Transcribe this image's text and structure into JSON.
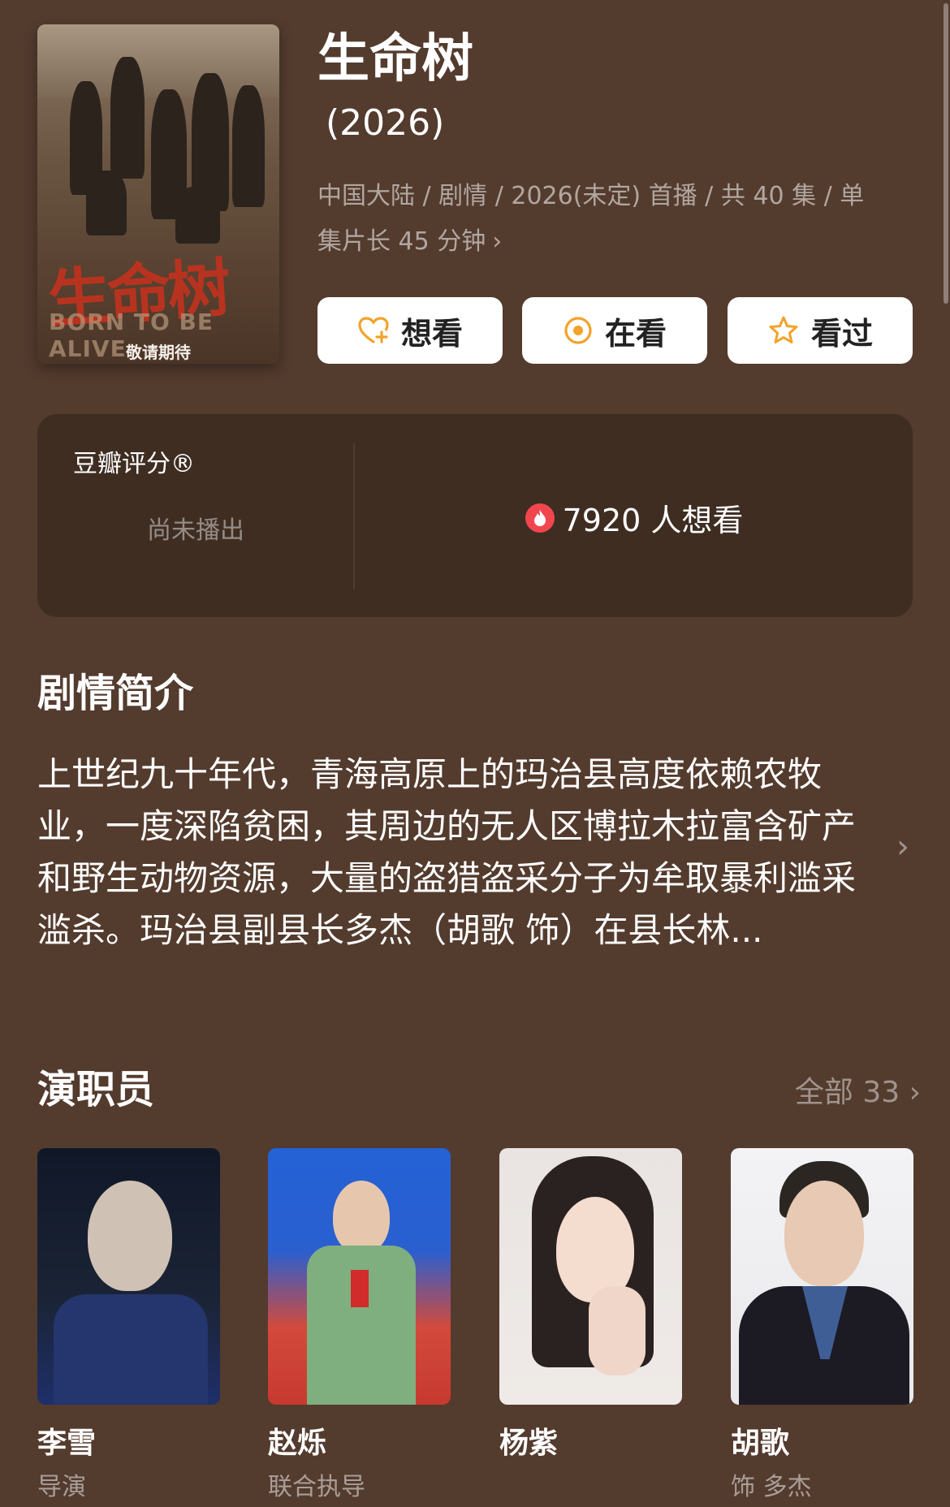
{
  "show": {
    "title": "生命树",
    "year": "(2026)",
    "meta_line1": "中国大陆 / 剧情 / 2026(未定) 首播 / 共 40 集 / 单",
    "meta_line2": "集片长 45 分钟",
    "poster": {
      "logo_text": "生命树",
      "subtitle": "BORN TO BE ALIVE",
      "note": "敬请期待"
    }
  },
  "actions": [
    {
      "label": "想看",
      "icon": "heart-plus-icon"
    },
    {
      "label": "在看",
      "icon": "target-circle-icon"
    },
    {
      "label": "看过",
      "icon": "star-icon"
    }
  ],
  "rating": {
    "label": "豆瓣评分®",
    "status": "尚未播出",
    "want_count": "7920 人想看"
  },
  "synopsis": {
    "title": "剧情简介",
    "text": "上世纪九十年代，青海高原上的玛治县高度依赖农牧业，一度深陷贫困，其周边的无人区博拉木拉富含矿产和野生动物资源，大量的盗猎盗采分子为牟取暴利滥采滥杀。玛治县副县长多杰（胡歌 饰）在县长林..."
  },
  "cast": {
    "title": "演职员",
    "all_label": "全部 33",
    "members": [
      {
        "name": "李雪",
        "role": "导演"
      },
      {
        "name": "赵烁",
        "role": "联合执导"
      },
      {
        "name": "杨紫",
        "role": ""
      },
      {
        "name": "胡歌",
        "role": "饰 多杰"
      }
    ]
  },
  "colors": {
    "background": "#533b2e",
    "card": "#3f2d22",
    "accent": "#f3a22a",
    "flame": "#f2464f"
  }
}
